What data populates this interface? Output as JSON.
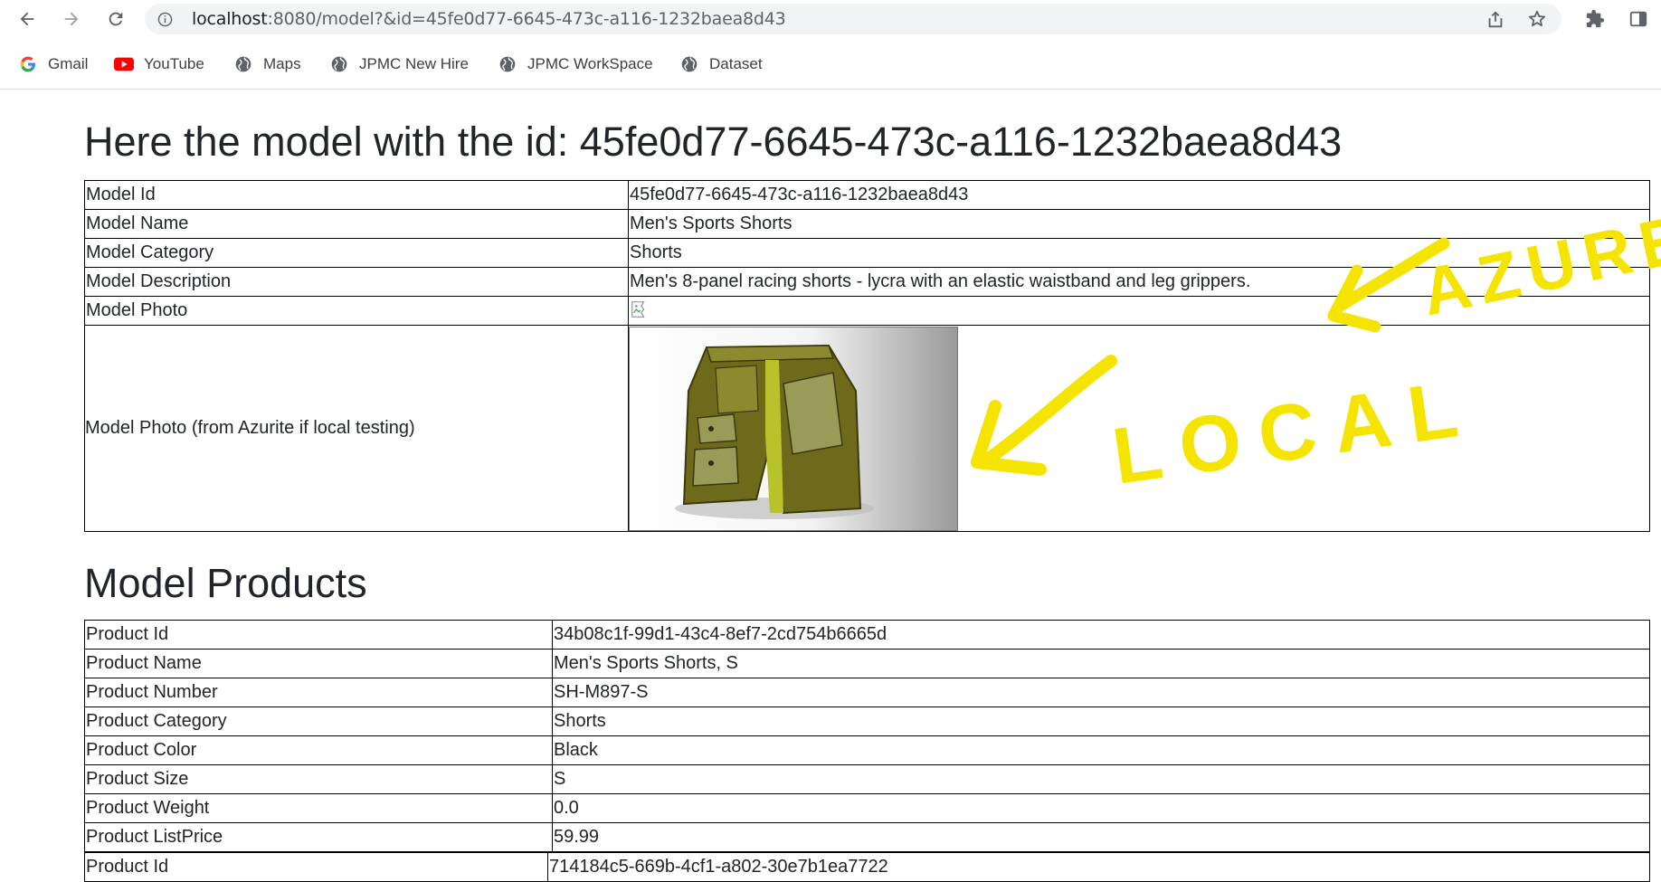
{
  "browser": {
    "url_host": "localhost",
    "url_rest": ":8080/model?&id=45fe0d77-6645-473c-a116-1232baea8d43",
    "bookmarks": [
      {
        "label": "Gmail",
        "icon": "google-icon"
      },
      {
        "label": "YouTube",
        "icon": "youtube-icon"
      },
      {
        "label": "Maps",
        "icon": "globe-icon"
      },
      {
        "label": "JPMC New Hire",
        "icon": "globe-icon"
      },
      {
        "label": "JPMC WorkSpace",
        "icon": "globe-icon"
      },
      {
        "label": "Dataset",
        "icon": "globe-icon"
      }
    ]
  },
  "page": {
    "title": "Here the model with the id: 45fe0d77-6645-473c-a116-1232baea8d43",
    "model": {
      "rows": [
        {
          "key": "Model Id",
          "value": "45fe0d77-6645-473c-a116-1232baea8d43"
        },
        {
          "key": "Model Name",
          "value": "Men's Sports Shorts"
        },
        {
          "key": "Model Category",
          "value": "Shorts"
        },
        {
          "key": "Model Description",
          "value": "Men's 8-panel racing shorts - lycra with an elastic waistband and leg grippers."
        },
        {
          "key": "Model Photo",
          "value": ""
        },
        {
          "key": "Model Photo (from Azurite if local testing)",
          "value": ""
        }
      ]
    },
    "products_heading": "Model Products",
    "products": [
      {
        "rows": [
          {
            "key": "Product Id",
            "value": "34b08c1f-99d1-43c4-8ef7-2cd754b6665d"
          },
          {
            "key": "Product Name",
            "value": "Men's Sports Shorts, S"
          },
          {
            "key": "Product Number",
            "value": "SH-M897-S"
          },
          {
            "key": "Product Category",
            "value": "Shorts"
          },
          {
            "key": "Product Color",
            "value": "Black"
          },
          {
            "key": "Product Size",
            "value": "S"
          },
          {
            "key": "Product Weight",
            "value": "0.0"
          },
          {
            "key": "Product ListPrice",
            "value": "59.99"
          }
        ]
      },
      {
        "rows": [
          {
            "key": "Product Id",
            "value": "714184c5-669b-4cf1-a802-30e7b1ea7722"
          }
        ]
      }
    ],
    "annotations": {
      "azure_text": "AZURE",
      "local_text": "LOCAL",
      "color": "#f5e400"
    }
  }
}
